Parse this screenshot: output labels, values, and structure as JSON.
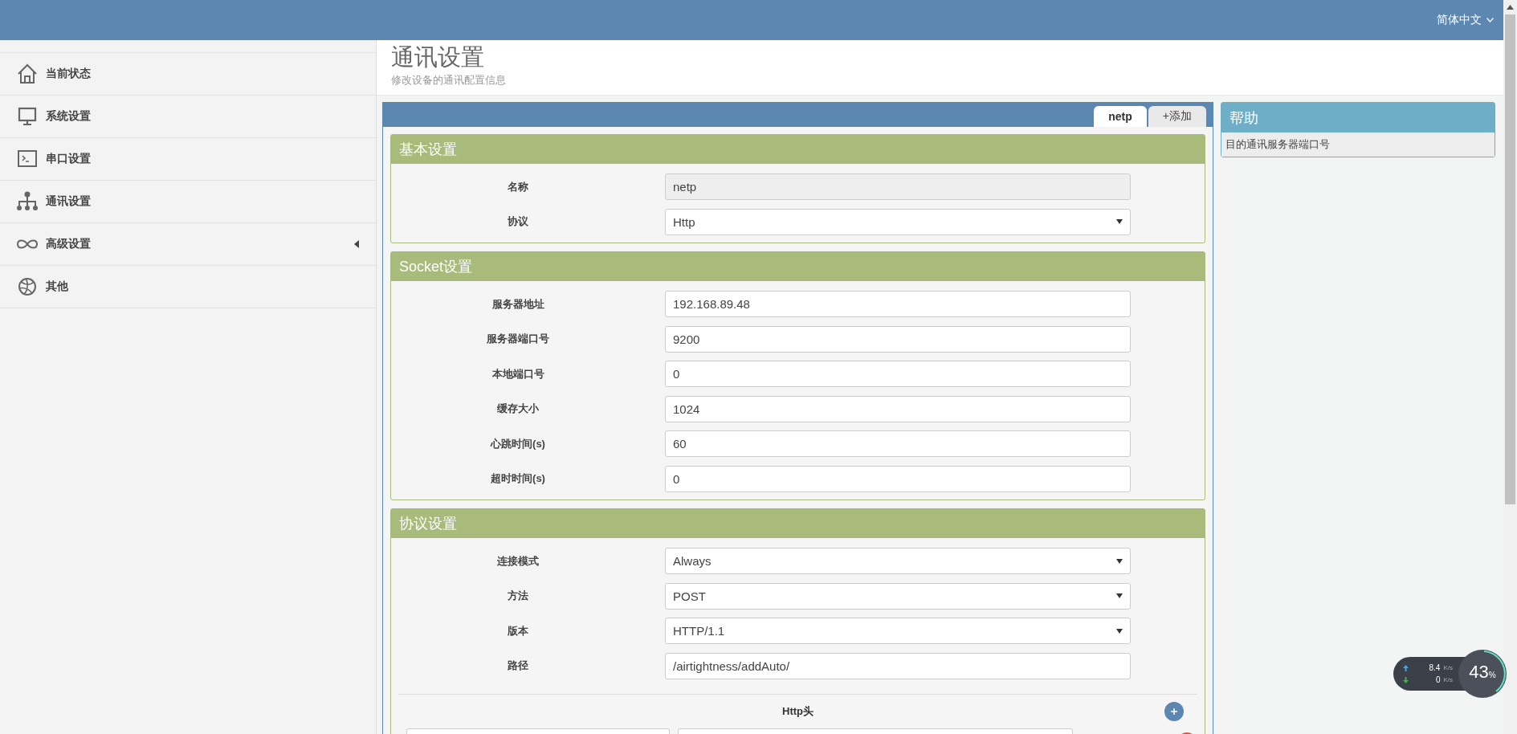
{
  "header": {
    "language": "简体中文"
  },
  "sidebar": {
    "items": [
      {
        "label": "当前状态",
        "kind": "home",
        "submenu": false
      },
      {
        "label": "系统设置",
        "kind": "monitor",
        "submenu": false
      },
      {
        "label": "串口设置",
        "kind": "terminal",
        "submenu": false
      },
      {
        "label": "通讯设置",
        "kind": "network",
        "submenu": false
      },
      {
        "label": "高级设置",
        "kind": "infinity",
        "submenu": true
      },
      {
        "label": "其他",
        "kind": "ball",
        "submenu": false
      }
    ]
  },
  "page": {
    "title": "通讯设置",
    "subtitle": "修改设备的通讯配置信息"
  },
  "tabs": [
    {
      "label": "netp",
      "selected": true
    },
    {
      "label": "+添加",
      "selected": false
    }
  ],
  "sections": [
    {
      "title": "基本设置",
      "fields": [
        {
          "label": "名称",
          "value": "netp",
          "kind": "text",
          "disabled": true
        },
        {
          "label": "协议",
          "value": "Http",
          "kind": "select",
          "disabled": false
        }
      ]
    },
    {
      "title": "Socket设置",
      "fields": [
        {
          "label": "服务器地址",
          "value": "192.168.89.48",
          "kind": "text",
          "disabled": false
        },
        {
          "label": "服务器端口号",
          "value": "9200",
          "kind": "text",
          "disabled": false
        },
        {
          "label": "本地端口号",
          "value": "0",
          "kind": "text",
          "disabled": false
        },
        {
          "label": "缓存大小",
          "value": "1024",
          "kind": "text",
          "disabled": false
        },
        {
          "label": "心跳时间(s)",
          "value": "60",
          "kind": "text",
          "disabled": false
        },
        {
          "label": "超时时间(s)",
          "value": "0",
          "kind": "text",
          "disabled": false
        }
      ]
    },
    {
      "title": "协议设置",
      "fields": [
        {
          "label": "连接模式",
          "value": "Always",
          "kind": "select",
          "disabled": false
        },
        {
          "label": "方法",
          "value": "POST",
          "kind": "select",
          "disabled": false
        },
        {
          "label": "版本",
          "value": "HTTP/1.1",
          "kind": "select",
          "disabled": false
        },
        {
          "label": "路径",
          "value": "/airtightness/addAuto/",
          "kind": "text",
          "disabled": false
        }
      ],
      "http_headers": {
        "title": "Http头"
      }
    }
  ],
  "help": {
    "title": "帮助",
    "text": "目的通讯服务器端口号"
  },
  "speed_widget": {
    "upload": "8.4",
    "upload_unit": "K/s",
    "download": "0",
    "download_unit": "K/s",
    "percent": "43",
    "percent_unit": "%"
  }
}
